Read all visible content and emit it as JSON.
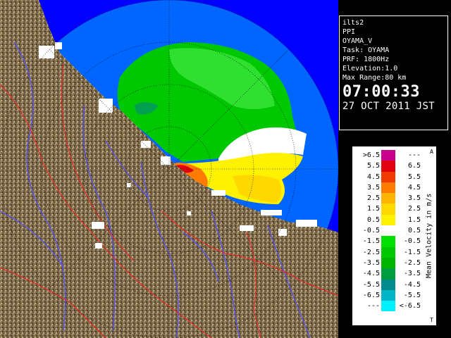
{
  "info": {
    "station": "ilts2",
    "product": "PPI",
    "radar": "OYAMA_V",
    "task": "Task: OYAMA",
    "prf": "PRF: 1800Hz",
    "elevation": "Elevation:1.0",
    "max_range": "Max Range:80 km",
    "time": "07:00:33",
    "date": "27 OCT 2011 JST"
  },
  "legend": {
    "title": "Mean Velocity in m/s",
    "corner_top": "A",
    "corner_bottom": "T",
    "rows": [
      {
        "lo": ">6.5",
        "hi": "---",
        "color": "#c8008c"
      },
      {
        "lo": "5.5",
        "hi": "6.5",
        "color": "#e00010"
      },
      {
        "lo": "4.5",
        "hi": "5.5",
        "color": "#f03a00"
      },
      {
        "lo": "3.5",
        "hi": "4.5",
        "color": "#ff7a00"
      },
      {
        "lo": "2.5",
        "hi": "3.5",
        "color": "#ffb400"
      },
      {
        "lo": "1.5",
        "hi": "2.5",
        "color": "#ffd800"
      },
      {
        "lo": "0.5",
        "hi": "1.5",
        "color": "#fff200"
      },
      {
        "lo": "-0.5",
        "hi": "0.5",
        "color": "#ffffff"
      },
      {
        "lo": "-1.5",
        "hi": "-0.5",
        "color": "#00e000"
      },
      {
        "lo": "-2.5",
        "hi": "-1.5",
        "color": "#00c800"
      },
      {
        "lo": "-3.5",
        "hi": "-2.5",
        "color": "#00b400"
      },
      {
        "lo": "-4.5",
        "hi": "-3.5",
        "color": "#009c40"
      },
      {
        "lo": "-5.5",
        "hi": "-4.5",
        "color": "#008c8c"
      },
      {
        "lo": "-6.5",
        "hi": "-5.5",
        "color": "#00b4c8"
      },
      {
        "lo": "---",
        "hi": "<-6.5",
        "color": "#00f0ff"
      }
    ]
  },
  "colors": {
    "sea_outer": "#0000ff",
    "sea_range": "#0066ff",
    "land": "#7a6a50",
    "river": "#5050ff",
    "border": "#ff2020"
  }
}
